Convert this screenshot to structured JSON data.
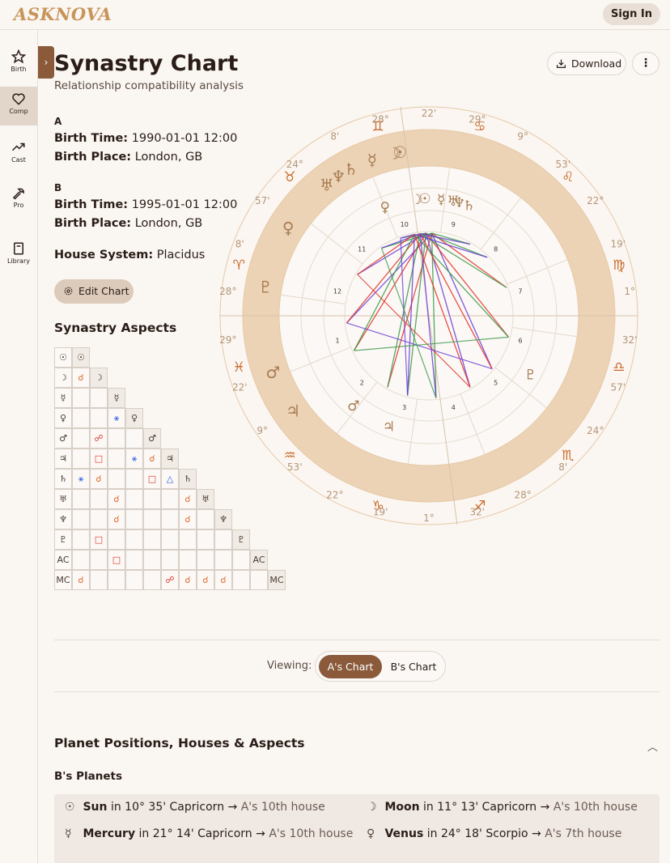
{
  "app": {
    "logo": "ASKNOVA",
    "sign_in": "Sign In"
  },
  "sidebar": {
    "items": [
      {
        "label": "Birth",
        "icon": "star-icon"
      },
      {
        "label": "Comp",
        "icon": "heart-icon"
      },
      {
        "label": "Cast",
        "icon": "trend-icon"
      },
      {
        "label": "Pro",
        "icon": "wrench-icon"
      },
      {
        "label": "Library",
        "icon": "book-icon"
      }
    ],
    "active": "Comp"
  },
  "header": {
    "title": "Synastry Chart",
    "subtitle": "Relationship compatibility analysis",
    "download": "Download"
  },
  "person_a": {
    "label": "A",
    "birth_time_label": "Birth Time:",
    "birth_time": "1990-01-01 12:00",
    "birth_place_label": "Birth Place:",
    "birth_place": "London, GB"
  },
  "person_b": {
    "label": "B",
    "birth_time_label": "Birth Time:",
    "birth_time": "1995-01-01 12:00",
    "birth_place_label": "Birth Place:",
    "birth_place": "London, GB"
  },
  "house_system": {
    "label": "House System:",
    "value": "Placidus"
  },
  "edit_chart": "Edit Chart",
  "aspects_title": "Synastry Aspects",
  "aspect_grid": {
    "planets": [
      "☉",
      "☽",
      "☿",
      "♀",
      "♂",
      "♃",
      "♄",
      "♅",
      "♆",
      "♇",
      "AC",
      "MC"
    ],
    "rows": [
      [
        ""
      ],
      [
        "☌",
        ""
      ],
      [
        "",
        "",
        ""
      ],
      [
        "",
        "",
        "⚹",
        ""
      ],
      [
        "",
        "☍",
        "",
        "",
        ""
      ],
      [
        "",
        "□",
        "",
        "⚹",
        "☌",
        ""
      ],
      [
        "⚹",
        "☌",
        "",
        "",
        "□",
        "△",
        ""
      ],
      [
        "",
        "",
        "☌",
        "",
        "",
        "",
        "☌",
        ""
      ],
      [
        "",
        "",
        "☌",
        "",
        "",
        "",
        "☌",
        "",
        ""
      ],
      [
        "",
        "□",
        "",
        "",
        "",
        "",
        "",
        "",
        "",
        ""
      ],
      [
        "",
        "",
        "□",
        "",
        "",
        "",
        "",
        "",
        "",
        "",
        ""
      ],
      [
        "☌",
        "",
        "",
        "",
        "",
        "☍",
        "☌",
        "☌",
        "☌",
        "",
        "",
        ""
      ]
    ]
  },
  "outer_wheel": {
    "labels": [
      "22'",
      "29°",
      "9°",
      "53'",
      "22°",
      "19'",
      "1°",
      "32'",
      "57'",
      "24°",
      "8'",
      "28°",
      "32'",
      "1°",
      "19'",
      "22°",
      "53'",
      "9°",
      "22'",
      "29°",
      "28°",
      "8'",
      "57'",
      "24°",
      "8'",
      "28°"
    ]
  },
  "view_toggle": {
    "label": "Viewing:",
    "a": "A's Chart",
    "b": "B's Chart",
    "selected": "A's Chart"
  },
  "positions_title": "Planet Positions, Houses & Aspects",
  "b_planets_title": "B's Planets",
  "b_planets": [
    {
      "symbol": "☉",
      "name": "Sun",
      "in": "in",
      "position": "10° 35' Capricorn",
      "arrow": "→",
      "house": "A's 10th house"
    },
    {
      "symbol": "☽",
      "name": "Moon",
      "in": "in",
      "position": "11° 13' Capricorn",
      "arrow": "→",
      "house": "A's 10th house"
    },
    {
      "symbol": "☿",
      "name": "Mercury",
      "in": "in",
      "position": "21° 14' Capricorn",
      "arrow": "→",
      "house": "A's 10th house"
    },
    {
      "symbol": "♀",
      "name": "Venus",
      "in": "in",
      "position": "24° 18' Scorpio",
      "arrow": "→",
      "house": "A's 7th house"
    }
  ],
  "colors": {
    "accent": "#8a5a3b",
    "zodiac_ring": "#ecd3b5",
    "trine": "#3c9a4a",
    "square": "#e0352b",
    "sextile": "#6a3cd6"
  }
}
